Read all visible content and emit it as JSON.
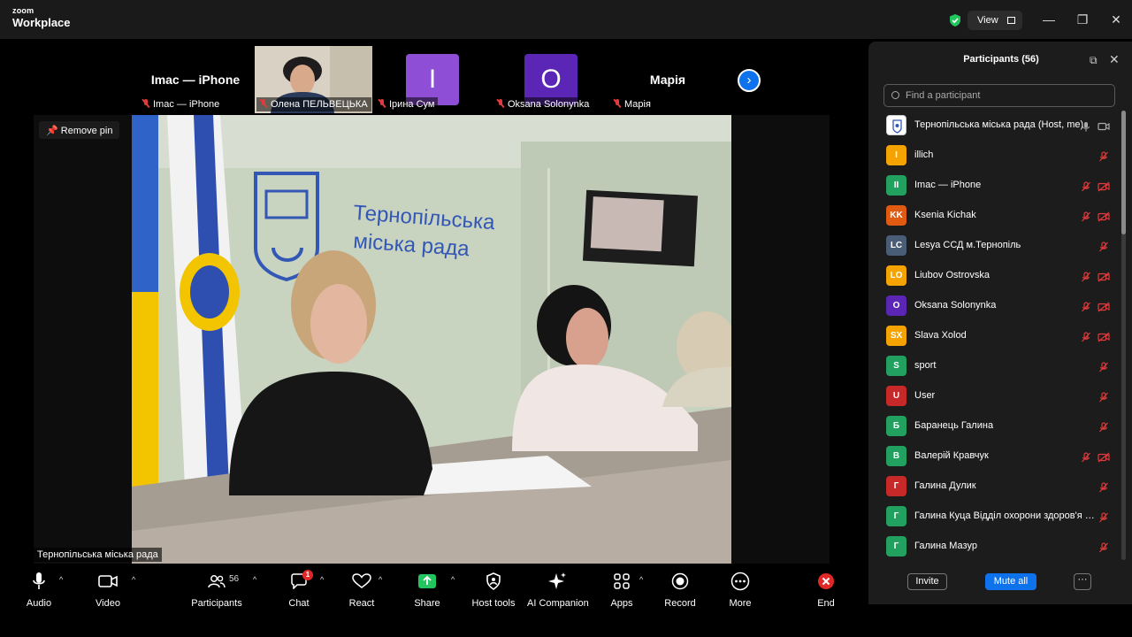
{
  "app": {
    "brand_top": "zoom",
    "brand_bottom": "Workplace",
    "view_label": "View"
  },
  "strip": [
    {
      "name": "Imac — iPhone",
      "label": "Imac — iPhone",
      "avatar": "",
      "color": ""
    },
    {
      "name": "",
      "label": "Олена ПЕЛЬВЕЦЬКА",
      "avatar": "",
      "color": ""
    },
    {
      "name": "",
      "label": "Ірина Сум",
      "avatar": "I",
      "color": "#8e4fd6"
    },
    {
      "name": "",
      "label": "Oksana Solonynka",
      "avatar": "O",
      "color": "#5b26b5"
    },
    {
      "name": "Марія",
      "label": "Марія",
      "avatar": "",
      "color": ""
    }
  ],
  "main": {
    "remove_pin": "Remove pin",
    "speaker_label": "Тернопільська міська рада",
    "wall_text_1": "Тернопільська",
    "wall_text_2": "міська рада"
  },
  "panel": {
    "title": "Participants (56)",
    "search_placeholder": "Find a participant",
    "participants": [
      {
        "initials": "",
        "name": "Тернопільська міська рада (Host, me)",
        "color": "#ffffff",
        "mic": "on",
        "cam": "on"
      },
      {
        "initials": "I",
        "name": "illich",
        "color": "#f5a300",
        "mic": "off",
        "cam": "none"
      },
      {
        "initials": "II",
        "name": "Imac — iPhone",
        "color": "#22a060",
        "mic": "off",
        "cam": "off"
      },
      {
        "initials": "KK",
        "name": "Ksenia Kichak",
        "color": "#e05a12",
        "mic": "off",
        "cam": "off"
      },
      {
        "initials": "LC",
        "name": "Lesya ССД м.Тернопіль",
        "color": "#4a5d77",
        "mic": "off",
        "cam": "none"
      },
      {
        "initials": "LO",
        "name": "Liubov Ostrovska",
        "color": "#f5a300",
        "mic": "off",
        "cam": "off"
      },
      {
        "initials": "O",
        "name": "Oksana Solonynka",
        "color": "#5b26b5",
        "mic": "off",
        "cam": "off"
      },
      {
        "initials": "SX",
        "name": "Slava Xolod",
        "color": "#f5a300",
        "mic": "off",
        "cam": "off"
      },
      {
        "initials": "S",
        "name": "sport",
        "color": "#22a060",
        "mic": "off",
        "cam": "none"
      },
      {
        "initials": "U",
        "name": "User",
        "color": "#c72828",
        "mic": "off",
        "cam": "none"
      },
      {
        "initials": "Б",
        "name": "Баранець Галина",
        "color": "#22a060",
        "mic": "off",
        "cam": "none"
      },
      {
        "initials": "В",
        "name": "Валерій Кравчук",
        "color": "#22a060",
        "mic": "off",
        "cam": "off"
      },
      {
        "initials": "Г",
        "name": "Галина Дулик",
        "color": "#c72828",
        "mic": "off",
        "cam": "none"
      },
      {
        "initials": "Г",
        "name": "Галина Куца Відділ охорони здоров'я та ...",
        "color": "#22a060",
        "mic": "off",
        "cam": "none"
      },
      {
        "initials": "Г",
        "name": "Галина Мазур",
        "color": "#22a060",
        "mic": "off",
        "cam": "none"
      }
    ],
    "invite": "Invite",
    "mute_all": "Mute all",
    "more": "···"
  },
  "toolbar": {
    "audio": "Audio",
    "video": "Video",
    "participants": "Participants",
    "participants_count": "56",
    "chat": "Chat",
    "chat_badge": "1",
    "react": "React",
    "share": "Share",
    "host_tools": "Host tools",
    "ai_companion": "AI Companion",
    "apps": "Apps",
    "record": "Record",
    "more": "More",
    "end": "End"
  },
  "colors": {
    "accent": "#0e72ed",
    "end": "#e02828",
    "share": "#22c55e",
    "panel_bg": "#1c1c1c"
  }
}
